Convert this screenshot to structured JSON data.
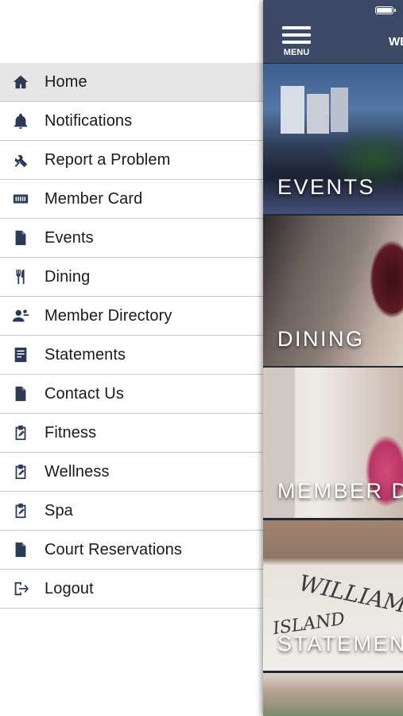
{
  "drawer": {
    "items": [
      {
        "label": "Home",
        "icon": "home-icon",
        "active": true
      },
      {
        "label": "Notifications",
        "icon": "bell-icon",
        "active": false
      },
      {
        "label": "Report a Problem",
        "icon": "tools-icon",
        "active": false
      },
      {
        "label": "Member Card",
        "icon": "card-icon",
        "active": false
      },
      {
        "label": "Events",
        "icon": "document-icon",
        "active": false
      },
      {
        "label": "Dining",
        "icon": "utensils-icon",
        "active": false
      },
      {
        "label": "Member Directory",
        "icon": "people-icon",
        "active": false
      },
      {
        "label": "Statements",
        "icon": "statement-icon",
        "active": false
      },
      {
        "label": "Contact Us",
        "icon": "document-icon",
        "active": false
      },
      {
        "label": "Fitness",
        "icon": "clipboard-edit-icon",
        "active": false
      },
      {
        "label": "Wellness",
        "icon": "clipboard-edit-icon",
        "active": false
      },
      {
        "label": "Spa",
        "icon": "clipboard-edit-icon",
        "active": false
      },
      {
        "label": "Court Reservations",
        "icon": "document-icon",
        "active": false
      },
      {
        "label": "Logout",
        "icon": "logout-icon",
        "active": false
      }
    ]
  },
  "topbar": {
    "menu_label": "MENU",
    "title": "WE"
  },
  "tiles": [
    {
      "label": "EVENTS"
    },
    {
      "label": "DINING"
    },
    {
      "label": "MEMBER D"
    },
    {
      "label": "STATEMEN"
    }
  ],
  "statement_art": {
    "line1": "WILLIAMS",
    "line2": "ISLAND"
  },
  "colors": {
    "nav_icon": "#2b3a57",
    "topbar_bg": "#3c4a66",
    "active_row_bg": "#e6e6e6",
    "divider": "#c9c9c9"
  }
}
